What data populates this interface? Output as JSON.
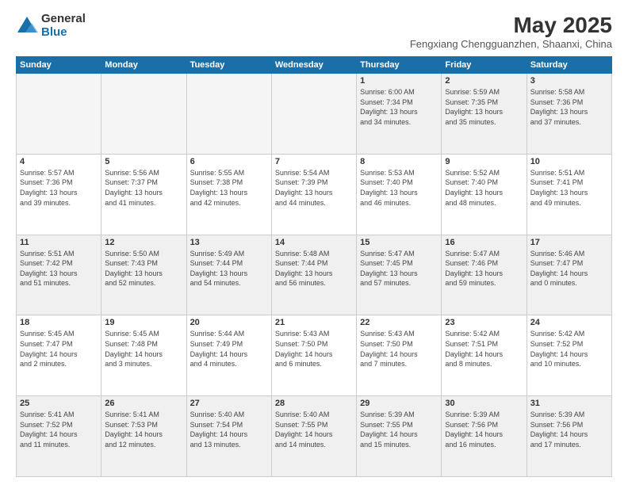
{
  "logo": {
    "general": "General",
    "blue": "Blue"
  },
  "title": "May 2025",
  "location": "Fengxiang Chengguanzhen, Shaanxi, China",
  "days_of_week": [
    "Sunday",
    "Monday",
    "Tuesday",
    "Wednesday",
    "Thursday",
    "Friday",
    "Saturday"
  ],
  "weeks": [
    [
      {
        "day": "",
        "info": "",
        "empty": true
      },
      {
        "day": "",
        "info": "",
        "empty": true
      },
      {
        "day": "",
        "info": "",
        "empty": true
      },
      {
        "day": "",
        "info": "",
        "empty": true
      },
      {
        "day": "1",
        "info": "Sunrise: 6:00 AM\nSunset: 7:34 PM\nDaylight: 13 hours\nand 34 minutes."
      },
      {
        "day": "2",
        "info": "Sunrise: 5:59 AM\nSunset: 7:35 PM\nDaylight: 13 hours\nand 35 minutes."
      },
      {
        "day": "3",
        "info": "Sunrise: 5:58 AM\nSunset: 7:36 PM\nDaylight: 13 hours\nand 37 minutes."
      }
    ],
    [
      {
        "day": "4",
        "info": "Sunrise: 5:57 AM\nSunset: 7:36 PM\nDaylight: 13 hours\nand 39 minutes."
      },
      {
        "day": "5",
        "info": "Sunrise: 5:56 AM\nSunset: 7:37 PM\nDaylight: 13 hours\nand 41 minutes."
      },
      {
        "day": "6",
        "info": "Sunrise: 5:55 AM\nSunset: 7:38 PM\nDaylight: 13 hours\nand 42 minutes."
      },
      {
        "day": "7",
        "info": "Sunrise: 5:54 AM\nSunset: 7:39 PM\nDaylight: 13 hours\nand 44 minutes."
      },
      {
        "day": "8",
        "info": "Sunrise: 5:53 AM\nSunset: 7:40 PM\nDaylight: 13 hours\nand 46 minutes."
      },
      {
        "day": "9",
        "info": "Sunrise: 5:52 AM\nSunset: 7:40 PM\nDaylight: 13 hours\nand 48 minutes."
      },
      {
        "day": "10",
        "info": "Sunrise: 5:51 AM\nSunset: 7:41 PM\nDaylight: 13 hours\nand 49 minutes."
      }
    ],
    [
      {
        "day": "11",
        "info": "Sunrise: 5:51 AM\nSunset: 7:42 PM\nDaylight: 13 hours\nand 51 minutes."
      },
      {
        "day": "12",
        "info": "Sunrise: 5:50 AM\nSunset: 7:43 PM\nDaylight: 13 hours\nand 52 minutes."
      },
      {
        "day": "13",
        "info": "Sunrise: 5:49 AM\nSunset: 7:44 PM\nDaylight: 13 hours\nand 54 minutes."
      },
      {
        "day": "14",
        "info": "Sunrise: 5:48 AM\nSunset: 7:44 PM\nDaylight: 13 hours\nand 56 minutes."
      },
      {
        "day": "15",
        "info": "Sunrise: 5:47 AM\nSunset: 7:45 PM\nDaylight: 13 hours\nand 57 minutes."
      },
      {
        "day": "16",
        "info": "Sunrise: 5:47 AM\nSunset: 7:46 PM\nDaylight: 13 hours\nand 59 minutes."
      },
      {
        "day": "17",
        "info": "Sunrise: 5:46 AM\nSunset: 7:47 PM\nDaylight: 14 hours\nand 0 minutes."
      }
    ],
    [
      {
        "day": "18",
        "info": "Sunrise: 5:45 AM\nSunset: 7:47 PM\nDaylight: 14 hours\nand 2 minutes."
      },
      {
        "day": "19",
        "info": "Sunrise: 5:45 AM\nSunset: 7:48 PM\nDaylight: 14 hours\nand 3 minutes."
      },
      {
        "day": "20",
        "info": "Sunrise: 5:44 AM\nSunset: 7:49 PM\nDaylight: 14 hours\nand 4 minutes."
      },
      {
        "day": "21",
        "info": "Sunrise: 5:43 AM\nSunset: 7:50 PM\nDaylight: 14 hours\nand 6 minutes."
      },
      {
        "day": "22",
        "info": "Sunrise: 5:43 AM\nSunset: 7:50 PM\nDaylight: 14 hours\nand 7 minutes."
      },
      {
        "day": "23",
        "info": "Sunrise: 5:42 AM\nSunset: 7:51 PM\nDaylight: 14 hours\nand 8 minutes."
      },
      {
        "day": "24",
        "info": "Sunrise: 5:42 AM\nSunset: 7:52 PM\nDaylight: 14 hours\nand 10 minutes."
      }
    ],
    [
      {
        "day": "25",
        "info": "Sunrise: 5:41 AM\nSunset: 7:52 PM\nDaylight: 14 hours\nand 11 minutes."
      },
      {
        "day": "26",
        "info": "Sunrise: 5:41 AM\nSunset: 7:53 PM\nDaylight: 14 hours\nand 12 minutes."
      },
      {
        "day": "27",
        "info": "Sunrise: 5:40 AM\nSunset: 7:54 PM\nDaylight: 14 hours\nand 13 minutes."
      },
      {
        "day": "28",
        "info": "Sunrise: 5:40 AM\nSunset: 7:55 PM\nDaylight: 14 hours\nand 14 minutes."
      },
      {
        "day": "29",
        "info": "Sunrise: 5:39 AM\nSunset: 7:55 PM\nDaylight: 14 hours\nand 15 minutes."
      },
      {
        "day": "30",
        "info": "Sunrise: 5:39 AM\nSunset: 7:56 PM\nDaylight: 14 hours\nand 16 minutes."
      },
      {
        "day": "31",
        "info": "Sunrise: 5:39 AM\nSunset: 7:56 PM\nDaylight: 14 hours\nand 17 minutes."
      }
    ]
  ]
}
